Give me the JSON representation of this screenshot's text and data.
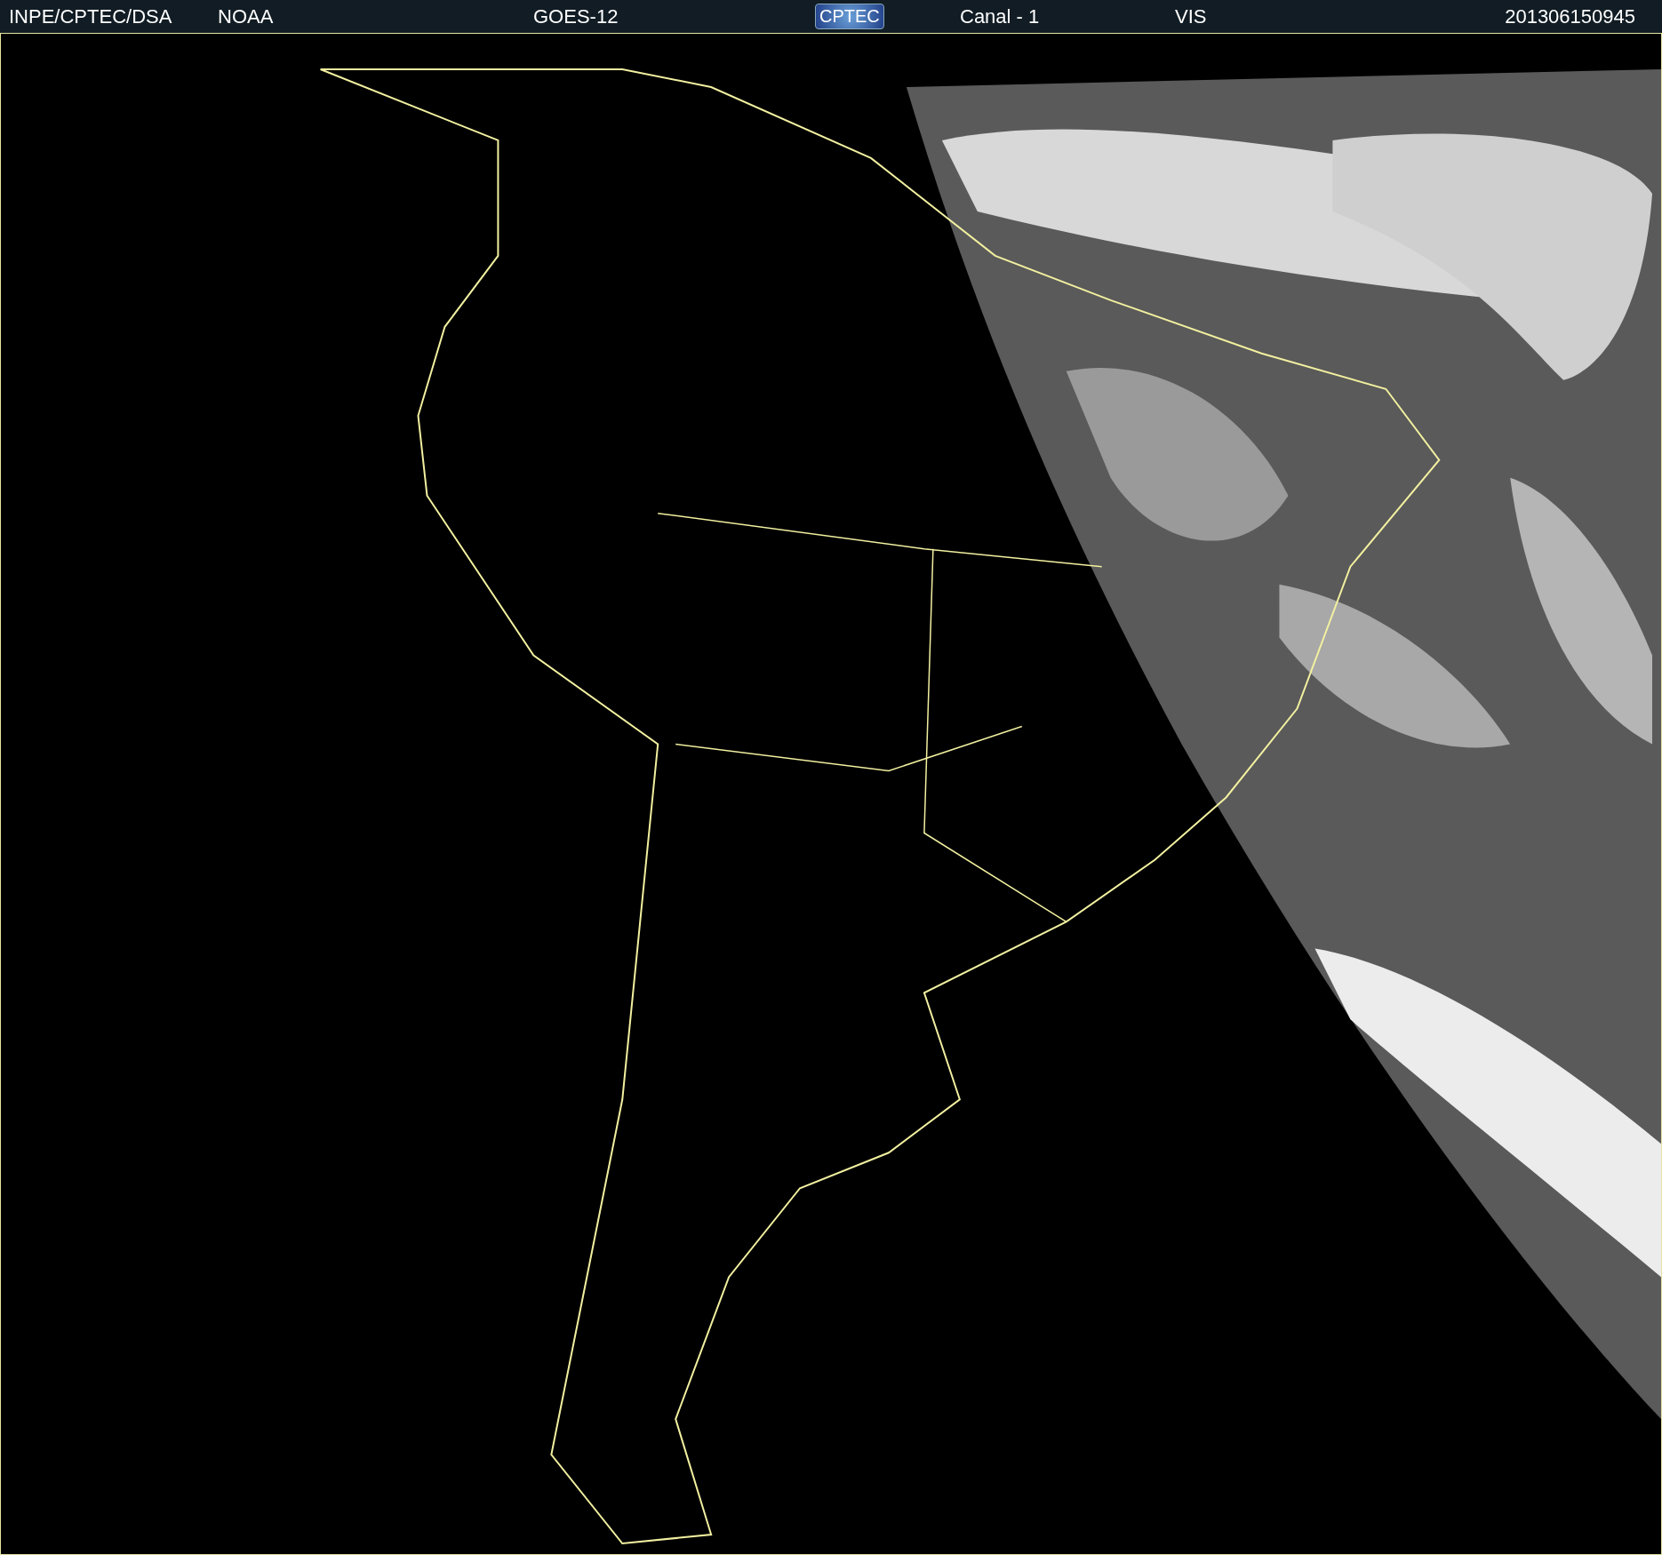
{
  "header": {
    "items": [
      {
        "kind": "text",
        "text": "INPE/CPTEC/DSA"
      },
      {
        "kind": "text",
        "text": "NOAA"
      },
      {
        "kind": "text",
        "text": "GOES-12"
      },
      {
        "kind": "logo",
        "text": "CPTEC"
      },
      {
        "kind": "text",
        "text": "Canal - 1"
      },
      {
        "kind": "text",
        "text": "VIS"
      },
      {
        "kind": "text",
        "text": "201306150945"
      }
    ]
  }
}
